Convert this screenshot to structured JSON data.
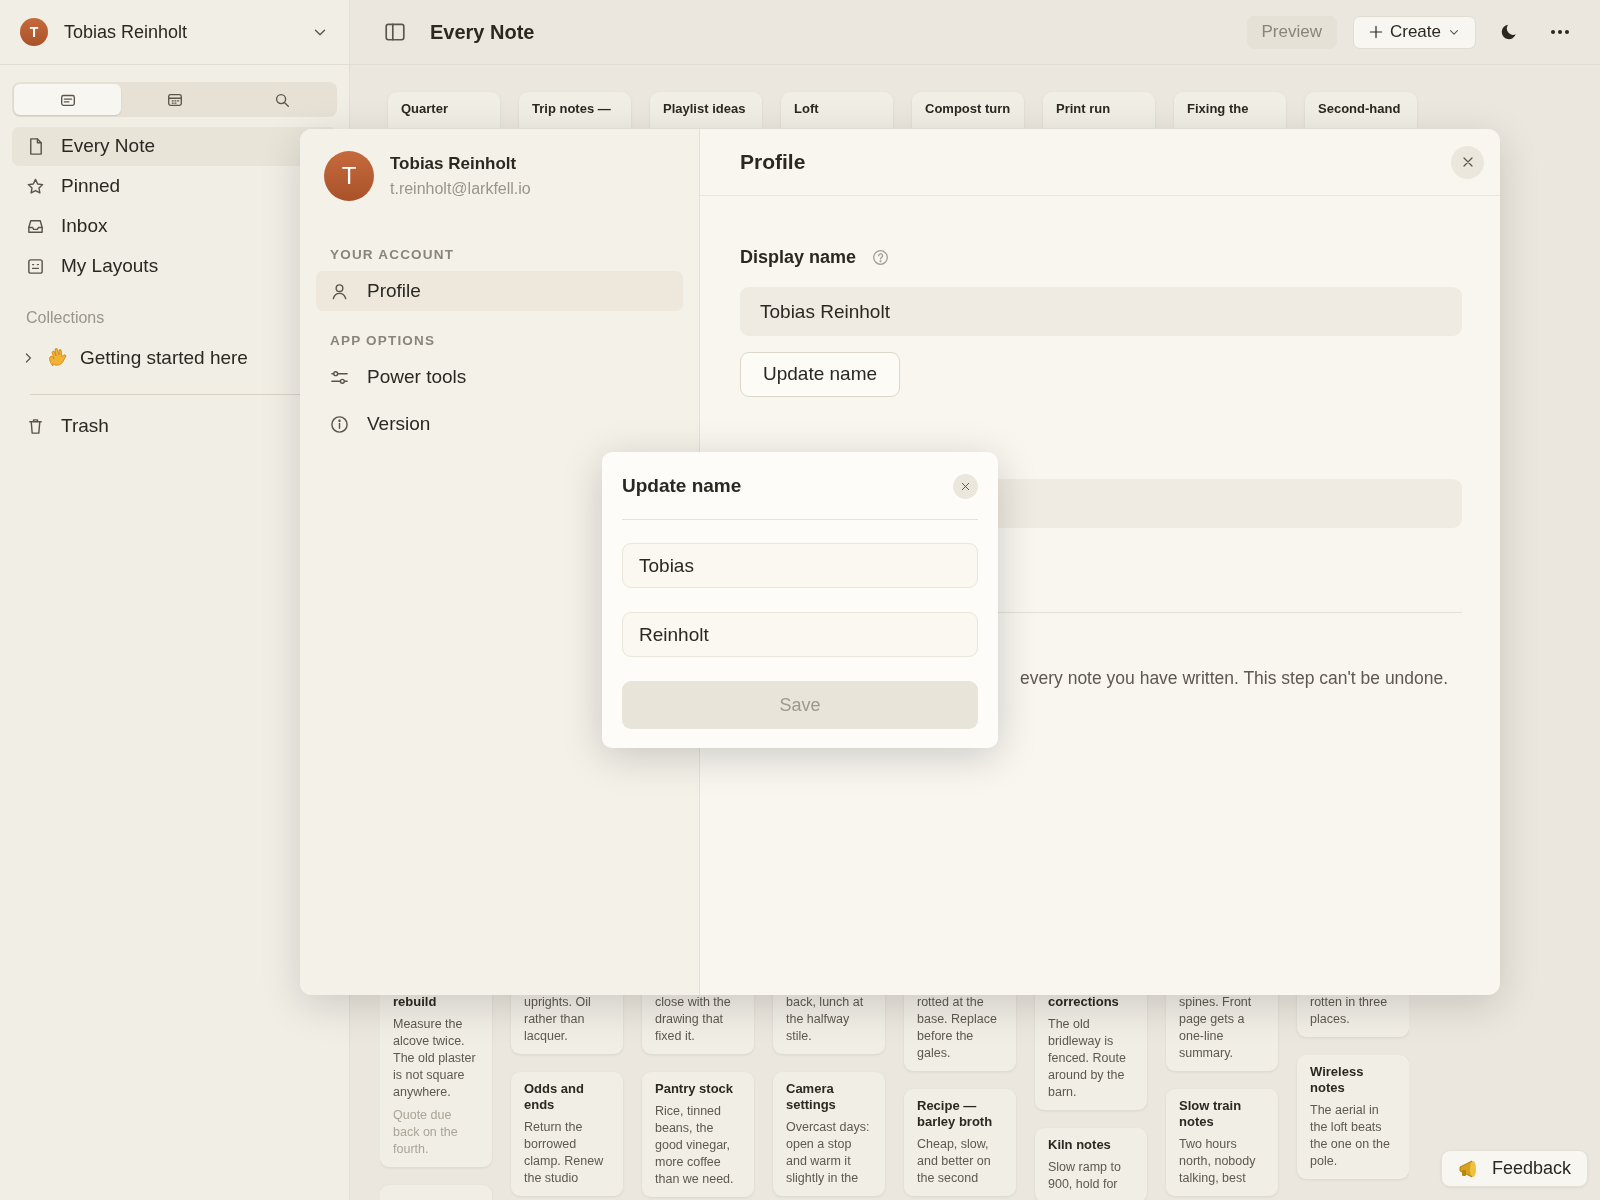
{
  "account": {
    "initial": "T",
    "name": "Tobias Reinholt"
  },
  "header": {
    "title": "Every Note",
    "buttons": [
      {
        "label": "Preview",
        "kind": "muted"
      },
      {
        "label": "Create",
        "kind": "dropdown"
      }
    ]
  },
  "sidebar_tabs": [
    {
      "kind": "notes",
      "selected": true
    },
    {
      "kind": "calendar",
      "selected": false
    },
    {
      "kind": "search",
      "selected": false
    }
  ],
  "nav": [
    {
      "label": "Every Note",
      "kind": "file",
      "selected": true
    },
    {
      "label": "Pinned",
      "kind": "star",
      "selected": false
    },
    {
      "label": "Inbox",
      "kind": "inbox",
      "selected": false
    },
    {
      "label": "My Layouts",
      "kind": "layout",
      "selected": false
    }
  ],
  "collections": {
    "heading": "Collections",
    "items": [
      {
        "label": "Getting started here",
        "expanded": false
      }
    ]
  },
  "trash": {
    "label": "Trash"
  },
  "notes_top": [
    "Quarter",
    "Trip notes —",
    "Playlist ideas",
    "Loft",
    "Compost turn",
    "Print run",
    "Fixing the",
    "Second-hand"
  ],
  "notes_bottom": [
    {
      "tail": {
        "title": "rebuild",
        "body": "Measure the alcove twice. The old plaster is not square anywhere.",
        "note": "Quote due back on the fourth."
      },
      "cards": [
        {
          "kind": "empty"
        }
      ]
    },
    {
      "tail": {
        "body": "uprights. Oil rather than lacquer."
      },
      "cards": [
        {
          "title": "Odds and ends",
          "body": "Return the borrowed clamp. Renew the studio"
        }
      ]
    },
    {
      "tail": {
        "body": "close with the drawing that fixed it."
      },
      "cards": [
        {
          "title": "Pantry stock",
          "body": "Rice, tinned beans, the good vinegar, more coffee than we need."
        }
      ]
    },
    {
      "tail": {
        "body": "back, lunch at the halfway stile."
      },
      "cards": [
        {
          "title": "Camera settings",
          "body": "Overcast days: open a stop and warm it slightly in the"
        }
      ]
    },
    {
      "tail": {
        "body": "rotted at the base. Replace before the gales."
      },
      "cards": [
        {
          "title": "Recipe — barley broth",
          "body": "Cheap, slow, and better on the second"
        }
      ]
    },
    {
      "tail": {
        "title": "corrections",
        "body": "The old bridleway is fenced. Route around by the barn."
      },
      "cards": [
        {
          "title": "Kiln notes",
          "body": "Slow ramp to 900, hold for"
        }
      ]
    },
    {
      "tail": {
        "body": "spines. Front page gets a one-line summary."
      },
      "cards": [
        {
          "title": "Slow train notes",
          "body": "Two hours north, nobody talking, best"
        }
      ]
    },
    {
      "tail": {
        "body": "rotten in three places."
      },
      "cards": [
        {
          "title": "Wireless notes",
          "body": "The aerial in the loft beats the one on the pole."
        }
      ]
    }
  ],
  "settings": {
    "user": {
      "initial": "T",
      "name": "Tobias Reinholt",
      "email": "t.reinholt@larkfell.io"
    },
    "sections": [
      {
        "heading": "YOUR ACCOUNT",
        "items": [
          {
            "label": "Profile",
            "kind": "person",
            "selected": true
          }
        ]
      },
      {
        "heading": "APP OPTIONS",
        "items": [
          {
            "label": "Power tools",
            "kind": "sliders",
            "selected": false
          },
          {
            "label": "Version",
            "kind": "info",
            "selected": false
          }
        ]
      }
    ],
    "panel": {
      "title": "Profile",
      "field_label": "Display name",
      "field_value": "Tobias Reinholt",
      "button": "Update name",
      "warning_tail": "every note you have written. This step can't be undone."
    }
  },
  "dialog": {
    "title": "Update name",
    "fields": [
      {
        "value": "Tobias"
      },
      {
        "value": "Reinholt"
      }
    ],
    "button": {
      "label": "Save",
      "disabled": true
    }
  },
  "feedback": {
    "label": "Feedback"
  }
}
